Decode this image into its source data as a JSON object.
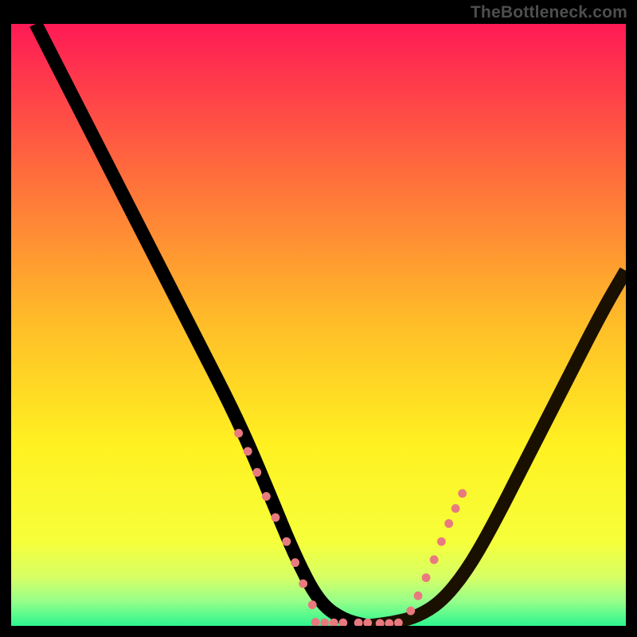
{
  "watermark": "TheBottleneck.com",
  "chart_data": {
    "type": "line",
    "title": "",
    "xlabel": "",
    "ylabel": "",
    "xlim": [
      0,
      100
    ],
    "ylim": [
      0,
      100
    ],
    "grid": false,
    "legend": false,
    "gradient_stops": [
      {
        "offset": 0,
        "color": "#ff1a55"
      },
      {
        "offset": 0.25,
        "color": "#ff6d3c"
      },
      {
        "offset": 0.5,
        "color": "#ffbe28"
      },
      {
        "offset": 0.7,
        "color": "#fff121"
      },
      {
        "offset": 0.86,
        "color": "#f6ff3a"
      },
      {
        "offset": 0.92,
        "color": "#d6ff66"
      },
      {
        "offset": 0.96,
        "color": "#94ff8a"
      },
      {
        "offset": 1.0,
        "color": "#2cf58e"
      }
    ],
    "series": [
      {
        "name": "bottleneck-curve-left",
        "x": [
          4,
          10,
          20,
          30,
          37,
          42,
          46,
          50,
          54,
          58
        ],
        "y": [
          100,
          88,
          68,
          48,
          34,
          22,
          12,
          4,
          1,
          0
        ]
      },
      {
        "name": "bottleneck-curve-right",
        "x": [
          58,
          62,
          66,
          70,
          74,
          78,
          84,
          90,
          96,
          100
        ],
        "y": [
          0,
          0.5,
          1.5,
          4,
          9,
          16,
          28,
          40,
          52,
          59
        ]
      }
    ],
    "flat_segments": [
      {
        "x0": 48,
        "x1": 55,
        "y": 0.3
      },
      {
        "x0": 56,
        "x1": 63,
        "y": 0.3
      }
    ],
    "highlight_dots": [
      {
        "x": 37.0,
        "y": 32.0
      },
      {
        "x": 38.5,
        "y": 29.0
      },
      {
        "x": 40.0,
        "y": 25.5
      },
      {
        "x": 41.5,
        "y": 21.5
      },
      {
        "x": 43.0,
        "y": 18.0
      },
      {
        "x": 44.8,
        "y": 14.0
      },
      {
        "x": 46.2,
        "y": 10.5
      },
      {
        "x": 47.5,
        "y": 7.0
      },
      {
        "x": 49.0,
        "y": 3.5
      },
      {
        "x": 49.5,
        "y": 0.6
      },
      {
        "x": 51.0,
        "y": 0.5
      },
      {
        "x": 52.5,
        "y": 0.5
      },
      {
        "x": 54.0,
        "y": 0.5
      },
      {
        "x": 56.5,
        "y": 0.5
      },
      {
        "x": 58.0,
        "y": 0.5
      },
      {
        "x": 60.0,
        "y": 0.4
      },
      {
        "x": 61.5,
        "y": 0.4
      },
      {
        "x": 63.0,
        "y": 0.5
      },
      {
        "x": 65.0,
        "y": 2.5
      },
      {
        "x": 66.2,
        "y": 5.0
      },
      {
        "x": 67.5,
        "y": 8.0
      },
      {
        "x": 68.8,
        "y": 11.0
      },
      {
        "x": 70.0,
        "y": 14.0
      },
      {
        "x": 71.2,
        "y": 17.0
      },
      {
        "x": 72.3,
        "y": 19.5
      },
      {
        "x": 73.4,
        "y": 22.0
      }
    ]
  }
}
